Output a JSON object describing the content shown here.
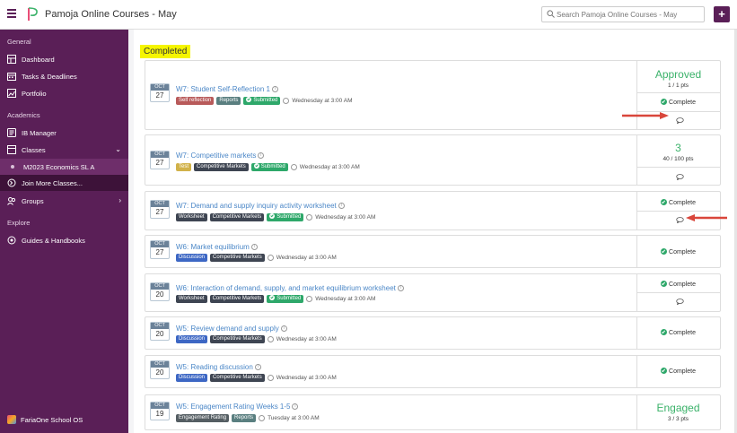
{
  "app": {
    "title": "Pamoja Online Courses - May"
  },
  "search": {
    "placeholder": "Search Pamoja Online Courses - May"
  },
  "toolbar": {
    "add_label": "+"
  },
  "sidebar": {
    "sections": {
      "general": "General",
      "academics": "Academics",
      "explore": "Explore"
    },
    "items": {
      "dashboard": "Dashboard",
      "tasks": "Tasks & Deadlines",
      "portfolio": "Portfolio",
      "ib_manager": "IB Manager",
      "classes": "Classes",
      "class_active": "M2023 Economics SL A",
      "join_more": "Join More Classes...",
      "groups": "Groups",
      "guides": "Guides & Handbooks"
    },
    "footer": "FariaOne School OS"
  },
  "main": {
    "heading": "Completed"
  },
  "assignments": [
    {
      "month": "OCT",
      "day": "27",
      "title": "W7: Student Self-Reflection 1",
      "tags": [
        "Self reflection",
        "Reports"
      ],
      "submitted": "Submitted",
      "due": "Wednesday at 3:00 AM",
      "score": "Approved",
      "points": "1 / 1 pts",
      "status": "Complete"
    },
    {
      "month": "OCT",
      "day": "27",
      "title": "W7: Competitive markets",
      "tags": [
        "Test",
        "Competitive Markets"
      ],
      "submitted": "Submitted",
      "due": "Wednesday at 3:00 AM",
      "score": "3",
      "points": "40 / 100 pts"
    },
    {
      "month": "OCT",
      "day": "27",
      "title": "W7: Demand and supply inquiry activity worksheet",
      "tags": [
        "Worksheet",
        "Competitive Markets"
      ],
      "submitted": "Submitted",
      "due": "Wednesday at 3:00 AM",
      "status": "Complete"
    },
    {
      "month": "OCT",
      "day": "27",
      "title": "W6: Market equilibrium",
      "tags": [
        "Discussion",
        "Competitive Markets"
      ],
      "due": "Wednesday at 3:00 AM",
      "status": "Complete"
    },
    {
      "month": "OCT",
      "day": "20",
      "title": "W6: Interaction of demand, supply, and market equilibrium worksheet",
      "tags": [
        "Worksheet",
        "Competitive Markets"
      ],
      "submitted": "Submitted",
      "due": "Wednesday at 3:00 AM",
      "status": "Complete"
    },
    {
      "month": "OCT",
      "day": "20",
      "title": "W5: Review demand and supply",
      "tags": [
        "Discussion",
        "Competitive Markets"
      ],
      "due": "Wednesday at 3:00 AM",
      "status": "Complete"
    },
    {
      "month": "OCT",
      "day": "20",
      "title": "W5: Reading discussion",
      "tags": [
        "Discussion",
        "Competitive Markets"
      ],
      "due": "Wednesday at 3:00 AM",
      "status": "Complete"
    },
    {
      "month": "OCT",
      "day": "19",
      "title": "W5: Engagement Rating Weeks 1-5",
      "tags": [
        "Engagement Rating",
        "Reports"
      ],
      "due": "Tuesday at 3:00 AM",
      "score": "Engaged",
      "points": "3 / 3 pts"
    }
  ],
  "colors": {
    "sidebar": "#5a1f57",
    "accent_green": "#3bb26a",
    "link_blue": "#4b87c7",
    "highlight": "#f5f500",
    "arrow": "#d9463b"
  }
}
